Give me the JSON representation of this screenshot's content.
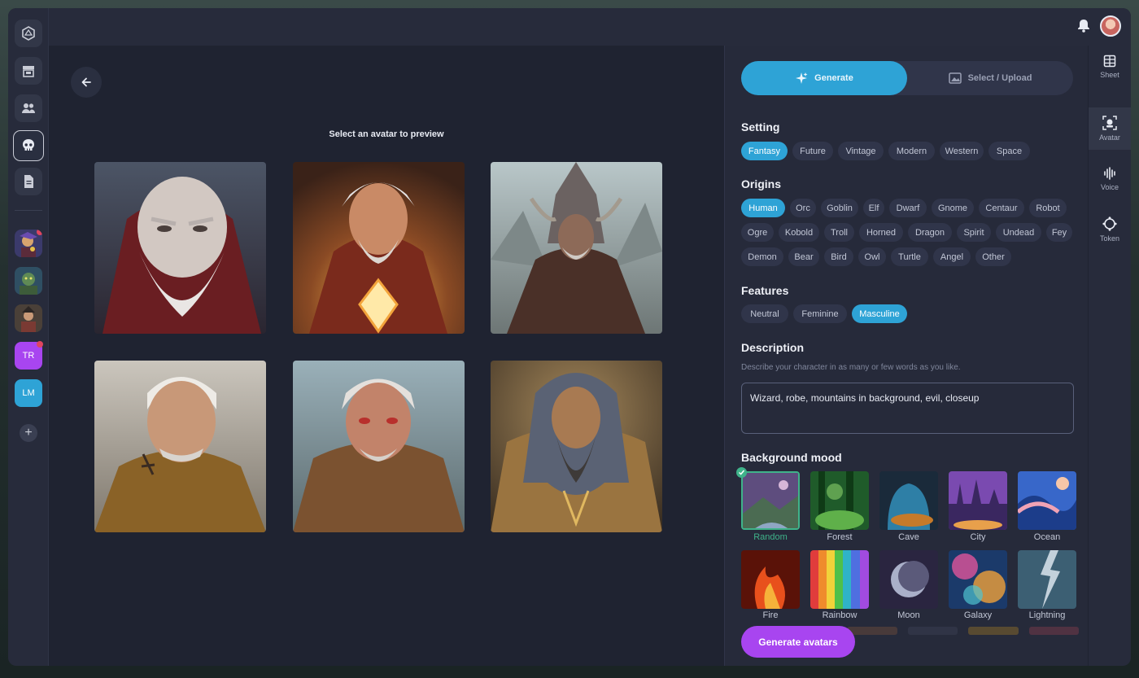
{
  "sidebar": {
    "avatars": [
      {
        "name": "rail-avatar-1",
        "has_notification": true
      },
      {
        "name": "rail-avatar-2",
        "has_notification": false
      },
      {
        "name": "rail-avatar-3",
        "has_notification": false
      }
    ],
    "text_items": [
      {
        "label": "TR",
        "color": "#a845f0",
        "has_notification": true
      },
      {
        "label": "LM",
        "color": "#2ea3d6",
        "has_notification": false
      }
    ]
  },
  "main": {
    "preview_hint": "Select an avatar to preview"
  },
  "panel": {
    "modes": {
      "generate": "Generate",
      "upload": "Select / Upload",
      "active": "Generate"
    },
    "setting": {
      "title": "Setting",
      "options": [
        "Fantasy",
        "Future",
        "Vintage",
        "Modern",
        "Western",
        "Space"
      ],
      "selected": "Fantasy"
    },
    "origins": {
      "title": "Origins",
      "options": [
        "Human",
        "Orc",
        "Goblin",
        "Elf",
        "Dwarf",
        "Gnome",
        "Centaur",
        "Robot",
        "Ogre",
        "Kobold",
        "Troll",
        "Horned",
        "Dragon",
        "Spirit",
        "Undead",
        "Fey",
        "Demon",
        "Bear",
        "Bird",
        "Owl",
        "Turtle",
        "Angel",
        "Other"
      ],
      "selected": "Human"
    },
    "features": {
      "title": "Features",
      "options": [
        "Neutral",
        "Feminine",
        "Masculine"
      ],
      "selected": "Masculine"
    },
    "description": {
      "title": "Description",
      "hint": "Describe your character in as many or few words as you like.",
      "value": "Wizard, robe, mountains in background, evil, closeup"
    },
    "background_mood": {
      "title": "Background mood",
      "options": [
        "Random",
        "Forest",
        "Cave",
        "City",
        "Ocean",
        "Fire",
        "Rainbow",
        "Moon",
        "Galaxy",
        "Lightning"
      ],
      "selected": "Random"
    },
    "generate_button": "Generate avatars"
  },
  "right_tabs": [
    {
      "label": "Sheet",
      "active": false
    },
    {
      "label": "Avatar",
      "active": true
    },
    {
      "label": "Voice",
      "active": false
    },
    {
      "label": "Token",
      "active": false
    }
  ],
  "colors": {
    "accent": "#2ea3d6",
    "purple": "#a845f0",
    "selected_green": "#3fb38a",
    "notification": "#e0455f"
  }
}
